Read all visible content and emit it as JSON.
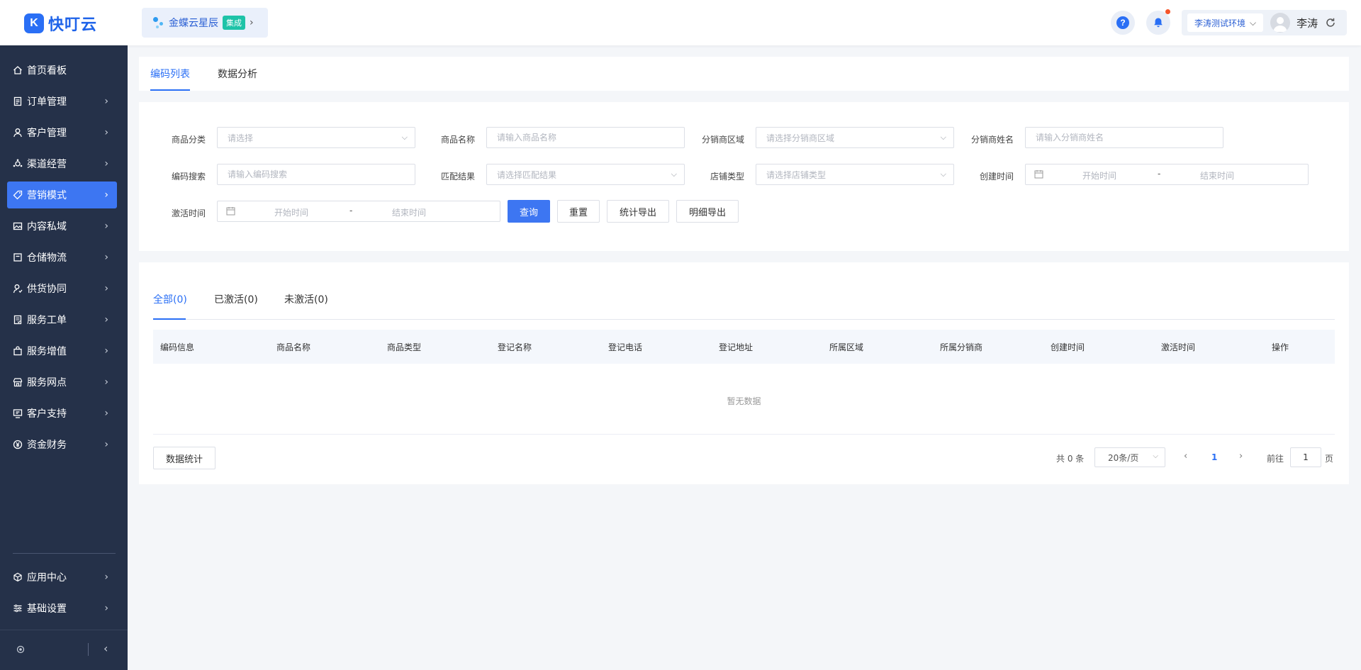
{
  "app": {
    "logo_letter": "K",
    "name": "快叮云"
  },
  "integration": {
    "name": "金蝶云星辰",
    "badge": "集成"
  },
  "header": {
    "environment": "李涛测试环境",
    "user_name": "李涛",
    "help_glyph": "?",
    "icons": [
      "help-icon",
      "bell-icon",
      "avatar",
      "refresh-icon"
    ]
  },
  "sidebar": {
    "items": [
      {
        "label": "首页看板",
        "icon": "home-icon",
        "has_arrow": false,
        "active": false
      },
      {
        "label": "订单管理",
        "icon": "order-icon",
        "has_arrow": true,
        "active": false
      },
      {
        "label": "客户管理",
        "icon": "user-icon",
        "has_arrow": true,
        "active": false
      },
      {
        "label": "渠道经营",
        "icon": "channel-icon",
        "has_arrow": true,
        "active": false
      },
      {
        "label": "营销模式",
        "icon": "tag-icon",
        "has_arrow": true,
        "active": true
      },
      {
        "label": "内容私域",
        "icon": "image-icon",
        "has_arrow": true,
        "active": false
      },
      {
        "label": "仓储物流",
        "icon": "box-icon",
        "has_arrow": true,
        "active": false
      },
      {
        "label": "供货协同",
        "icon": "supply-icon",
        "has_arrow": true,
        "active": false
      },
      {
        "label": "服务工单",
        "icon": "ticket-icon",
        "has_arrow": true,
        "active": false
      },
      {
        "label": "服务增值",
        "icon": "bag-icon",
        "has_arrow": true,
        "active": false
      },
      {
        "label": "服务网点",
        "icon": "store-icon",
        "has_arrow": true,
        "active": false
      },
      {
        "label": "客户支持",
        "icon": "support-icon",
        "has_arrow": true,
        "active": false
      },
      {
        "label": "资金财务",
        "icon": "yuan-icon",
        "has_arrow": true,
        "active": false
      }
    ],
    "bottom_items": [
      {
        "label": "应用中心",
        "icon": "cube-icon"
      },
      {
        "label": "基础设置",
        "icon": "settings-icon"
      }
    ]
  },
  "top_tabs": [
    {
      "label": "编码列表",
      "active": true
    },
    {
      "label": "数据分析",
      "active": false
    }
  ],
  "filters": {
    "product_category": {
      "label": "商品分类",
      "placeholder": "请选择"
    },
    "product_name": {
      "label": "商品名称",
      "placeholder": "请输入商品名称"
    },
    "distributor_region": {
      "label": "分销商区域",
      "placeholder": "请选择分销商区域"
    },
    "distributor_name": {
      "label": "分销商姓名",
      "placeholder": "请输入分销商姓名"
    },
    "code_search": {
      "label": "编码搜索",
      "placeholder": "请输入编码搜索"
    },
    "match_result": {
      "label": "匹配结果",
      "placeholder": "请选择匹配结果"
    },
    "store_type": {
      "label": "店铺类型",
      "placeholder": "请选择店铺类型"
    },
    "created_time": {
      "label": "创建时间",
      "start": "开始时间",
      "sep": "-",
      "end": "结束时间"
    },
    "activated_time": {
      "label": "激活时间",
      "start": "开始时间",
      "sep": "-",
      "end": "结束时间"
    },
    "buttons": {
      "query": "查询",
      "reset": "重置",
      "stat_export": "统计导出",
      "detail_export": "明细导出"
    }
  },
  "status_tabs": [
    {
      "label": "全部(0)",
      "active": true
    },
    {
      "label": "已激活(0)",
      "active": false
    },
    {
      "label": "未激活(0)",
      "active": false
    }
  ],
  "table": {
    "columns": [
      "编码信息",
      "商品名称",
      "商品类型",
      "登记名称",
      "登记电话",
      "登记地址",
      "所属区域",
      "所属分销商",
      "创建时间",
      "激活时间",
      "操作"
    ],
    "empty_text": "暂无数据"
  },
  "footer": {
    "stats_button": "数据统计",
    "total": "共 0 条",
    "page_size": "20条/页",
    "current_page": "1",
    "jump_prefix": "前往",
    "jump_value": "1",
    "jump_suffix": "页"
  },
  "colors": {
    "primary": "#3d76f2",
    "sidebar_bg": "#253149",
    "badge": "#1ec3a8",
    "notification_dot": "#f5542a"
  }
}
